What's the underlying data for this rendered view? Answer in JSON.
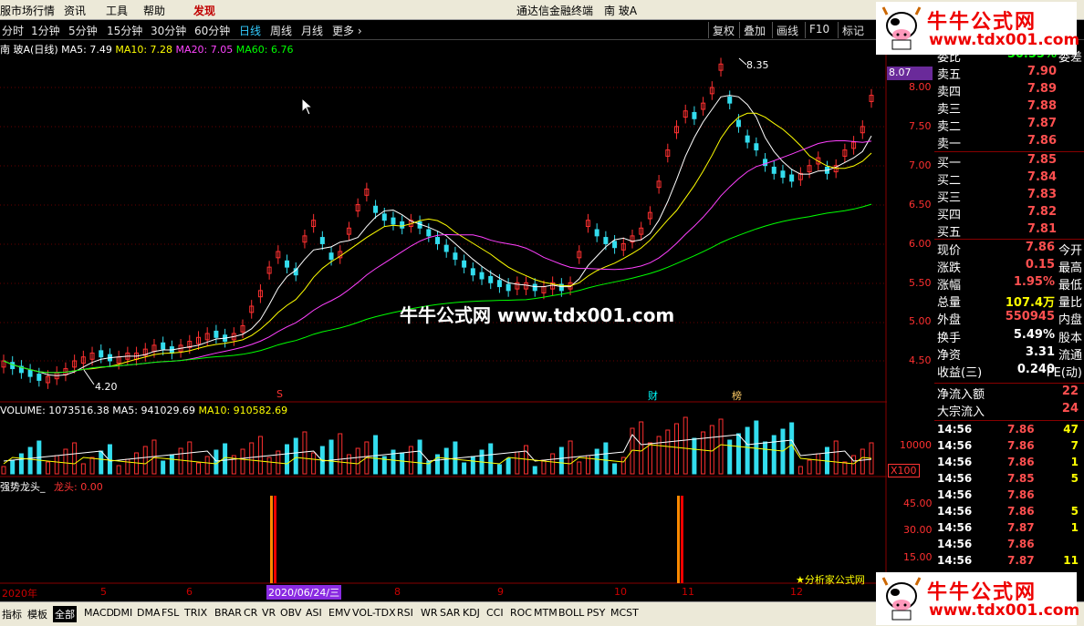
{
  "menu": {
    "items": [
      "服市场行情",
      "资讯",
      "工具",
      "帮助",
      "发现"
    ],
    "title": "通达信金融终端",
    "stock": "南 玻A"
  },
  "periods": [
    "分时",
    "1分钟",
    "5分钟",
    "15分钟",
    "30分钟",
    "60分钟",
    "日线",
    "周线",
    "月线",
    "更多 ›"
  ],
  "active_period": "日线",
  "right_buttons": [
    "复权",
    "叠加",
    "画线",
    "F10",
    "标记"
  ],
  "legend": {
    "name": "南 玻A(日线)",
    "ma5": "MA5: 7.49",
    "ma10": "MA10: 7.28",
    "ma20": "MA20: 7.05",
    "ma60": "MA60: 6.76"
  },
  "price_tags": {
    "high": "8.35",
    "low": "4.20"
  },
  "current_price_tag": "8.07",
  "price_scale": [
    "8.00",
    "7.50",
    "7.00",
    "6.50",
    "6.00",
    "5.50",
    "5.00",
    "4.50"
  ],
  "volume_legend": {
    "label": "VOLUME: 1073516.38",
    "ma5": "MA5: 941029.69",
    "ma10": "MA10: 910582.69"
  },
  "volume_scale": [
    "10000"
  ],
  "volume_unit": "X100",
  "indicator_legend": {
    "name": "强势龙头_",
    "value": "龙头: 0.00"
  },
  "indicator_scale": [
    "45.00",
    "30.00",
    "15.00"
  ],
  "markers": {
    "m1": "S",
    "m2": "财",
    "m3": "榜"
  },
  "watermark": "牛牛公式网 www.tdx001.com",
  "logo": {
    "title": "牛牛公式网",
    "url": "www.tdx001.com"
  },
  "order_book": {
    "top_label": "委比",
    "top_value": "50.55%",
    "top_right": "委差",
    "sell": [
      {
        "label": "卖五",
        "price": "7.90"
      },
      {
        "label": "卖四",
        "price": "7.89"
      },
      {
        "label": "卖三",
        "price": "7.88"
      },
      {
        "label": "卖二",
        "price": "7.87"
      },
      {
        "label": "卖一",
        "price": "7.86"
      }
    ],
    "buy": [
      {
        "label": "买一",
        "price": "7.85"
      },
      {
        "label": "买二",
        "price": "7.84"
      },
      {
        "label": "买三",
        "price": "7.83"
      },
      {
        "label": "买四",
        "price": "7.82"
      },
      {
        "label": "买五",
        "price": "7.81"
      }
    ]
  },
  "stats": [
    {
      "l": "现价",
      "v": "7.86",
      "l2": "今开",
      "color": "#ff5050"
    },
    {
      "l": "涨跌",
      "v": "0.15",
      "l2": "最高",
      "color": "#ff5050"
    },
    {
      "l": "涨幅",
      "v": "1.95%",
      "l2": "最低",
      "color": "#ff5050"
    },
    {
      "l": "总量",
      "v": "107.4万",
      "l2": "量比",
      "color": "#ffff00"
    },
    {
      "l": "外盘",
      "v": "550945",
      "l2": "内盘",
      "color": "#ff5050"
    },
    {
      "l": "换手",
      "v": "5.49%",
      "l2": "股本",
      "color": "#ffffff"
    },
    {
      "l": "净资",
      "v": "3.31",
      "l2": "流通",
      "color": "#ffffff"
    },
    {
      "l": "收益(三)",
      "v": "0.240",
      "l2": "PE(动)",
      "color": "#ffffff"
    }
  ],
  "flows": [
    {
      "l": "净流入额",
      "v": "22"
    },
    {
      "l": "大宗流入",
      "v": "24"
    }
  ],
  "ticks": [
    {
      "t": "14:56",
      "p": "7.86",
      "q": "47"
    },
    {
      "t": "14:56",
      "p": "7.86",
      "q": "7"
    },
    {
      "t": "14:56",
      "p": "7.86",
      "q": "1"
    },
    {
      "t": "14:56",
      "p": "7.85",
      "q": "5"
    },
    {
      "t": "14:56",
      "p": "7.86",
      "q": ""
    },
    {
      "t": "14:56",
      "p": "7.86",
      "q": "5"
    },
    {
      "t": "14:56",
      "p": "7.87",
      "q": "1"
    },
    {
      "t": "14:56",
      "p": "7.86",
      "q": ""
    },
    {
      "t": "14:56",
      "p": "7.87",
      "q": "11"
    }
  ],
  "dates": [
    "2020年",
    "5",
    "6",
    "2020/06/24/三",
    "8",
    "9",
    "10",
    "11",
    "12"
  ],
  "analyst": "★分析家公式网",
  "tabs": [
    "指标",
    "模板",
    "全部",
    "MACD",
    "DMI",
    "DMA",
    "FSL",
    "TRIX",
    "BRAR",
    "CR",
    "VR",
    "OBV",
    "ASI",
    "EMV",
    "VOL-TDX",
    "RSI",
    "WR",
    "SAR",
    "KDJ",
    "CCI",
    "ROC",
    "MTM",
    "BOLL",
    "PSY",
    "MCST"
  ],
  "active_tab": "全部",
  "colors": {
    "up": "#ff3030",
    "down": "#33ddee",
    "ma5": "#ffffff",
    "ma10": "#ffff00",
    "ma20": "#ff40ff",
    "ma60": "#00ff00"
  }
}
